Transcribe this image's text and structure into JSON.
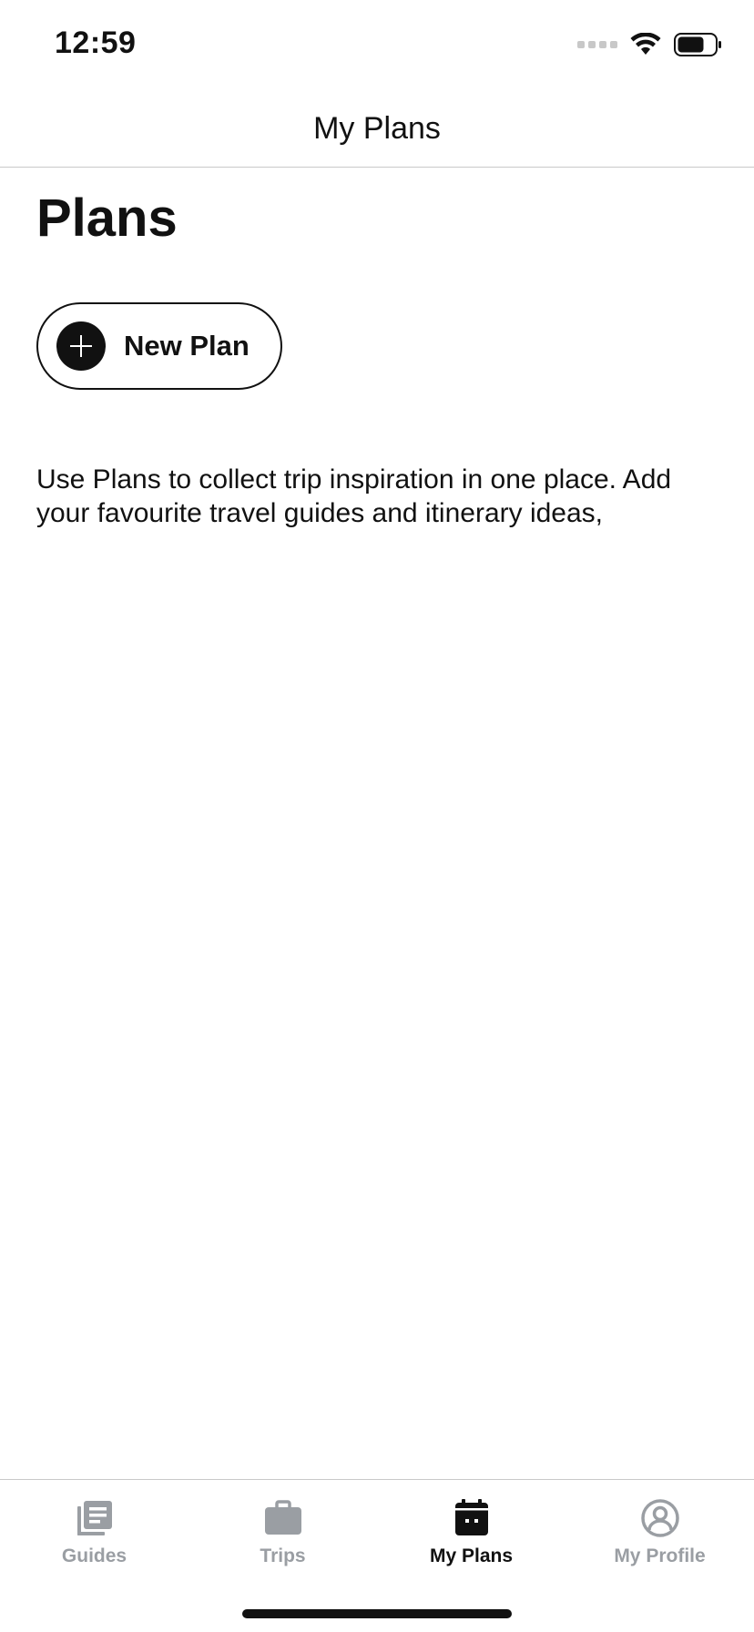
{
  "status_bar": {
    "time": "12:59",
    "icons": [
      "cellular-icon",
      "wifi-icon",
      "battery-icon"
    ]
  },
  "nav": {
    "title": "My Plans"
  },
  "main": {
    "title": "Plans",
    "new_plan_label": "New Plan",
    "description": "Use Plans to collect trip inspiration in one place. Add your favourite travel guides and itinerary ideas,"
  },
  "tabs": [
    {
      "label": "Guides",
      "icon": "guides-icon",
      "active": false
    },
    {
      "label": "Trips",
      "icon": "briefcase-icon",
      "active": false
    },
    {
      "label": "My Plans",
      "icon": "calendar-icon",
      "active": true
    },
    {
      "label": "My Profile",
      "icon": "profile-icon",
      "active": false
    }
  ],
  "colors": {
    "primary": "#111111",
    "inactive_tab": "#9a9ea3",
    "divider": "#c9c9c9",
    "background": "#ffffff"
  }
}
